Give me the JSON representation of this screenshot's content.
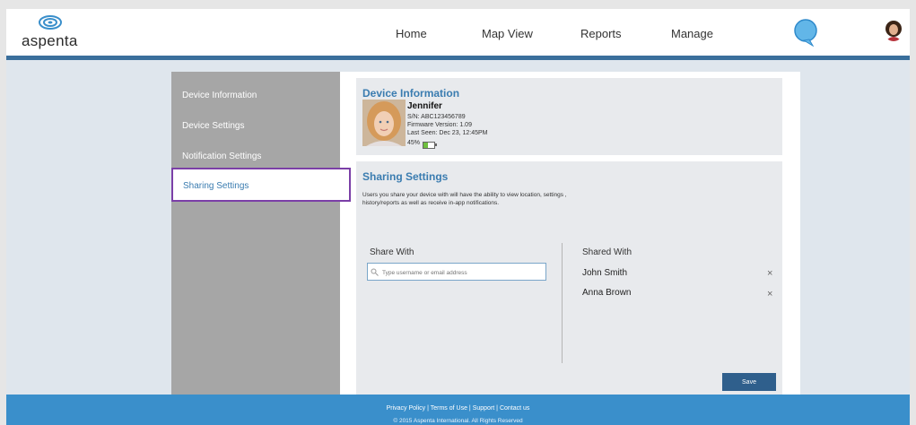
{
  "brand": {
    "name": "aspenta"
  },
  "nav": {
    "items": [
      "Home",
      "Map View",
      "Reports",
      "Manage"
    ]
  },
  "sidebar": {
    "items": [
      {
        "label": "Device Information"
      },
      {
        "label": "Device Settings"
      },
      {
        "label": "Notification Settings"
      },
      {
        "label": "Sharing Settings",
        "active": true
      }
    ]
  },
  "device": {
    "heading": "Device Information",
    "name": "Jennifer",
    "serial": "S/N: ABC123456789",
    "firmware": "Firmware Version: 1.09",
    "last_seen": "Last Seen: Dec 23, 12:45PM",
    "battery_text": "45%",
    "battery_level": 0.45
  },
  "sharing": {
    "heading": "Sharing Settings",
    "description": "Users you share your device with will have the ability to view location, settings , history/reports as well as receive in-app notifications.",
    "share_with_label": "Share With",
    "search_placeholder": "Type username or email address",
    "shared_with_label": "Shared With",
    "shared_users": [
      "John Smith",
      "Anna Brown"
    ],
    "remove_symbol": "×",
    "save_label": "Save"
  },
  "footer": {
    "links": [
      "Privacy Policy",
      "Terms of Use",
      "Support",
      "Contact us"
    ],
    "separator": " | ",
    "copyright": "© 2015 Aspenta International. All Rights Reserved"
  },
  "colors": {
    "accent": "#3a7cb0",
    "topbar_border": "#3a6f9c",
    "footer": "#3a8fcb",
    "sidebar": "#a6a6a6",
    "active_outline": "#7b3fa7",
    "save_button": "#2f5f8c"
  },
  "icons": [
    "aspenta-logo-icon",
    "chat-bubble-icon",
    "user-avatar",
    "battery-icon",
    "search-icon",
    "close-icon"
  ]
}
